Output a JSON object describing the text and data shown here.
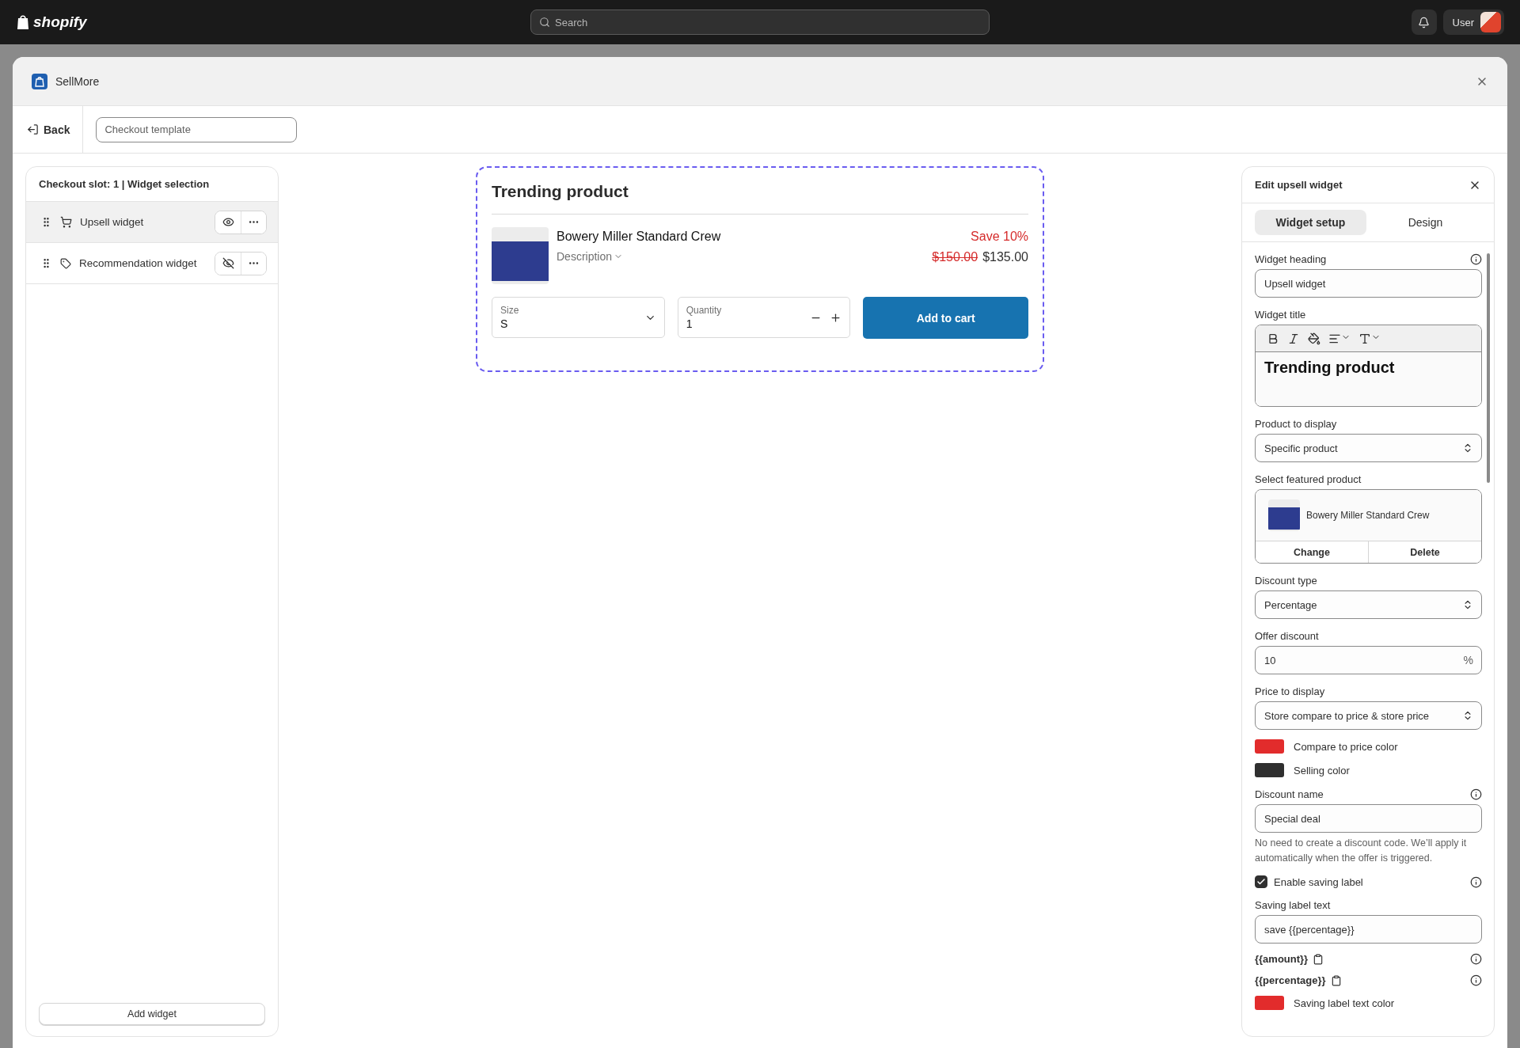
{
  "topbar": {
    "logo": "shopify",
    "search_placeholder": "Search",
    "user": "User"
  },
  "app": {
    "name": "SellMore"
  },
  "toolbar": {
    "back": "Back",
    "template_placeholder": "Checkout template"
  },
  "slot_panel": {
    "title": "Checkout slot: 1 | Widget selection",
    "widgets": [
      {
        "label": "Upsell widget",
        "kind": "upsell",
        "visible": true,
        "selected": true
      },
      {
        "label": "Recommendation widget",
        "kind": "recommendation",
        "visible": false,
        "selected": false
      }
    ],
    "add_button": "Add widget"
  },
  "preview": {
    "title": "Trending product",
    "product": "Bowery Miller Standard Crew",
    "description": "Description",
    "save": "Save 10%",
    "compare_price": "$150.00",
    "price": "$135.00",
    "size_label": "Size",
    "size_value": "S",
    "quantity_label": "Quantity",
    "quantity_value": "1",
    "button": "Add to cart"
  },
  "editor": {
    "title": "Edit upsell widget",
    "tabs": [
      {
        "label": "Widget setup",
        "selected": true
      },
      {
        "label": "Design",
        "selected": false
      }
    ],
    "fields": [
      {
        "kind": "text",
        "label": "Widget heading",
        "value": "Upsell widget",
        "info": true
      },
      {
        "kind": "richtext",
        "label": "Widget title",
        "value": "Trending product"
      },
      {
        "kind": "select",
        "label": "Product to display",
        "value": "Specific product"
      },
      {
        "kind": "product",
        "label": "Select featured product",
        "product": "Bowery Miller Standard Crew",
        "actions": [
          "Change",
          "Delete"
        ]
      },
      {
        "kind": "select",
        "label": "Discount type",
        "value": "Percentage"
      },
      {
        "kind": "text",
        "label": "Offer discount",
        "value": "10",
        "suffix": "%"
      },
      {
        "kind": "select",
        "label": "Price to display",
        "value": "Store compare to price & store price"
      },
      {
        "kind": "color",
        "label": "Compare to price color",
        "color": "#e22c2c"
      },
      {
        "kind": "color",
        "label": "Selling color",
        "color": "#2f2f2f"
      },
      {
        "kind": "text",
        "label": "Discount name",
        "value": "Special deal",
        "info": true,
        "help": "No need to create a discount code. We’ll apply it automatically when the offer is triggered."
      },
      {
        "kind": "checkbox",
        "label": "Enable saving label",
        "checked": true,
        "info": true
      },
      {
        "kind": "text",
        "label": "Saving label text",
        "value": "save {{percentage}}"
      },
      {
        "kind": "token",
        "label": "{{amount}}",
        "info": true
      },
      {
        "kind": "token",
        "label": "{{percentage}}",
        "info": true
      },
      {
        "kind": "color",
        "label": "Saving label text color",
        "color": "#e22c2c"
      }
    ]
  }
}
